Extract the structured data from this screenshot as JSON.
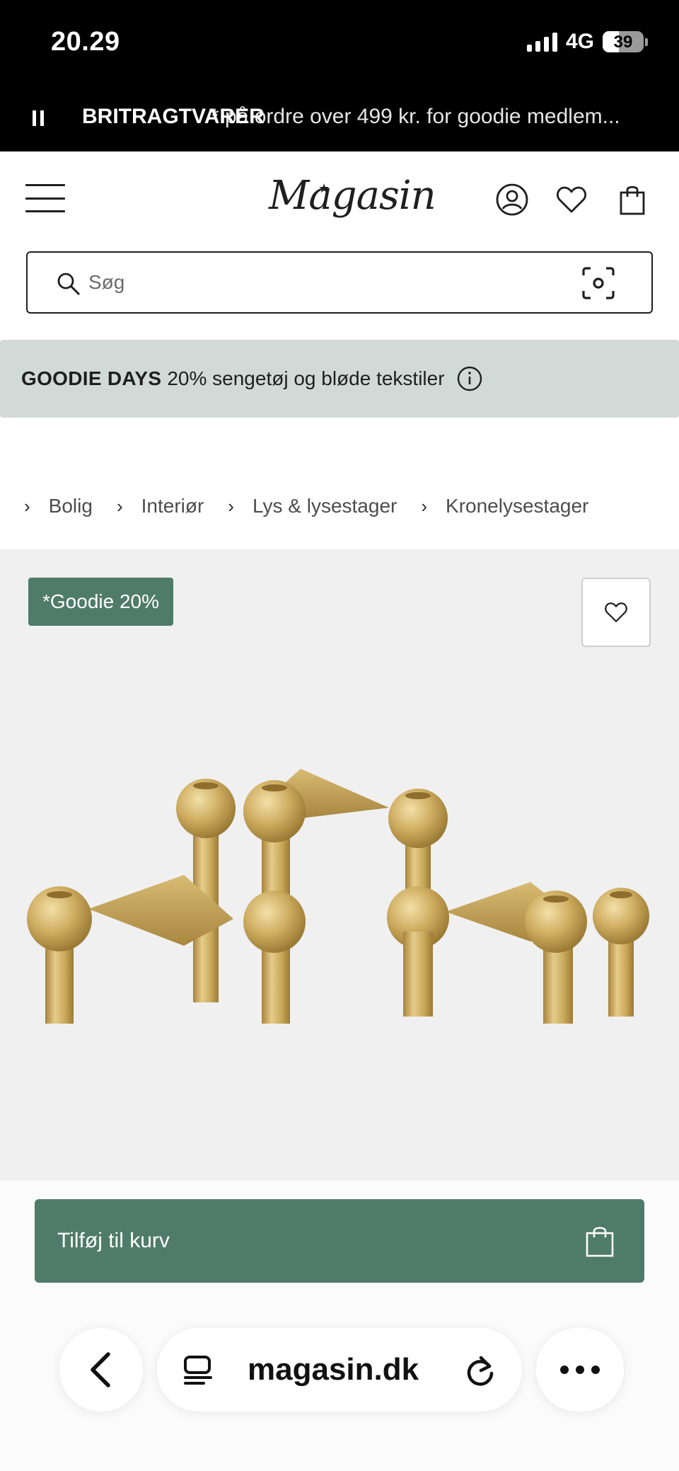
{
  "status_bar": {
    "time": "20.29",
    "network": "4G",
    "battery": "39",
    "battery_level": 0.39
  },
  "announcement": {
    "text_primary": "BRITRAGTVARER",
    "text_secondary": "* på ordre over 499 kr. for goodie medlem..."
  },
  "header": {
    "logo": "Magasin",
    "icons": [
      "account-icon",
      "wishlist-icon",
      "bag-icon"
    ]
  },
  "search": {
    "placeholder": "Søg"
  },
  "promo": {
    "title": "GOODIE DAYS",
    "text": "20% sengetøj og bløde tekstiler"
  },
  "breadcrumb": {
    "items": [
      {
        "label": "Bolig"
      },
      {
        "label": "Interiør"
      },
      {
        "label": "Lys & lysestager"
      },
      {
        "label": "Kronelysestager"
      }
    ]
  },
  "product": {
    "badge": "*Goodie 20%",
    "image_alt": "Brass stacking candle holders"
  },
  "cart": {
    "button_label": "Tilføj til kurv"
  },
  "browser": {
    "url": "magasin.dk"
  },
  "colors": {
    "accent": "#4f7b6a",
    "promo_bg": "#d1dad7",
    "product_bg": "#f0f0f0",
    "brass": "#c9a95a"
  }
}
